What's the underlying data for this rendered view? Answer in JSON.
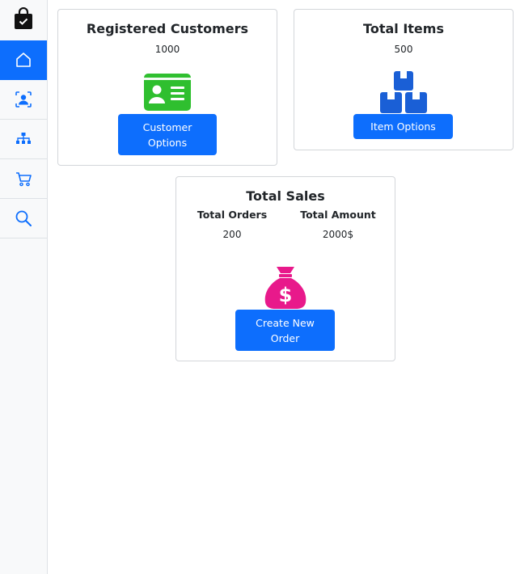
{
  "sidebar": {
    "logo_icon": "shopping-bag-check-icon",
    "items": [
      {
        "name": "home",
        "icon": "house-icon",
        "active": true
      },
      {
        "name": "customers",
        "icon": "person-badge-icon",
        "active": false
      },
      {
        "name": "categories",
        "icon": "sitemap-icon",
        "active": false
      },
      {
        "name": "cart",
        "icon": "cart-icon",
        "active": false
      },
      {
        "name": "search",
        "icon": "search-icon",
        "active": false
      }
    ]
  },
  "customers_card": {
    "title": "Registered Customers",
    "value": "1000",
    "icon": "id-card-icon",
    "button_label": "Customer Options"
  },
  "items_card": {
    "title": "Total Items",
    "value": "500",
    "icon": "boxes-icon",
    "button_label": "Item Options"
  },
  "sales_card": {
    "title": "Total Sales",
    "orders_label": "Total Orders",
    "orders_value": "200",
    "amount_label": "Total Amount",
    "amount_value": "2000$",
    "icon": "money-bag-icon",
    "button_label": "Create New Order"
  },
  "colors": {
    "primary": "#0d6efd",
    "sidebar_bg": "#f8f9fa",
    "id_card_green": "#2fbf2f",
    "boxes_blue": "#1a5fd6",
    "money_bag_pink": "#e8198b"
  }
}
